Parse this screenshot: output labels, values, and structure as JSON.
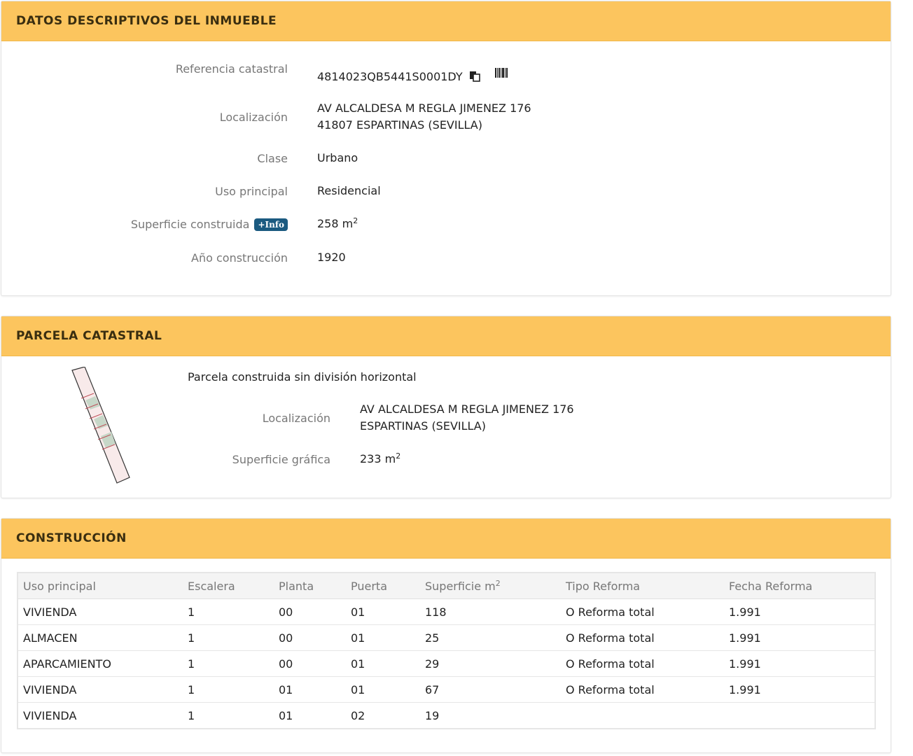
{
  "datos": {
    "title": "DATOS DESCRIPTIVOS DEL INMUEBLE",
    "ref_label": "Referencia catastral",
    "ref_value": "4814023QB5441S0001DY",
    "loc_label": "Localización",
    "loc_line1": "AV ALCALDESA M REGLA JIMENEZ 176",
    "loc_line2": "41807 ESPARTINAS (SEVILLA)",
    "clase_label": "Clase",
    "clase_value": "Urbano",
    "uso_label": "Uso principal",
    "uso_value": "Residencial",
    "sup_label": "Superficie construida",
    "info_badge": "+Info",
    "sup_value": "258 m",
    "sup_exp": "2",
    "anio_label": "Año construcción",
    "anio_value": "1920"
  },
  "parcela": {
    "title": "PARCELA CATASTRAL",
    "desc": "Parcela construida sin división horizontal",
    "loc_label": "Localización",
    "loc_line1": "AV ALCALDESA M REGLA JIMENEZ 176",
    "loc_line2": "ESPARTINAS (SEVILLA)",
    "sup_label": "Superficie gráfica",
    "sup_value": "233 m",
    "sup_exp": "2"
  },
  "construccion": {
    "title": "CONSTRUCCIÓN",
    "headers": [
      "Uso principal",
      "Escalera",
      "Planta",
      "Puerta",
      "Superficie m",
      "Tipo Reforma",
      "Fecha Reforma"
    ],
    "sup_header_exp": "2",
    "rows": [
      [
        "VIVIENDA",
        "1",
        "00",
        "01",
        "118",
        "O Reforma total",
        "1.991"
      ],
      [
        "ALMACEN",
        "1",
        "00",
        "01",
        "25",
        "O Reforma total",
        "1.991"
      ],
      [
        "APARCAMIENTO",
        "1",
        "00",
        "01",
        "29",
        "O Reforma total",
        "1.991"
      ],
      [
        "VIVIENDA",
        "1",
        "01",
        "01",
        "67",
        "O Reforma total",
        "1.991"
      ],
      [
        "VIVIENDA",
        "1",
        "01",
        "02",
        "19",
        "",
        ""
      ]
    ]
  },
  "icons": {
    "copy": "copy-icon",
    "barcode": "barcode-icon"
  },
  "colors": {
    "header_bg": "#fcc55e",
    "badge_bg": "#1b5a80"
  }
}
